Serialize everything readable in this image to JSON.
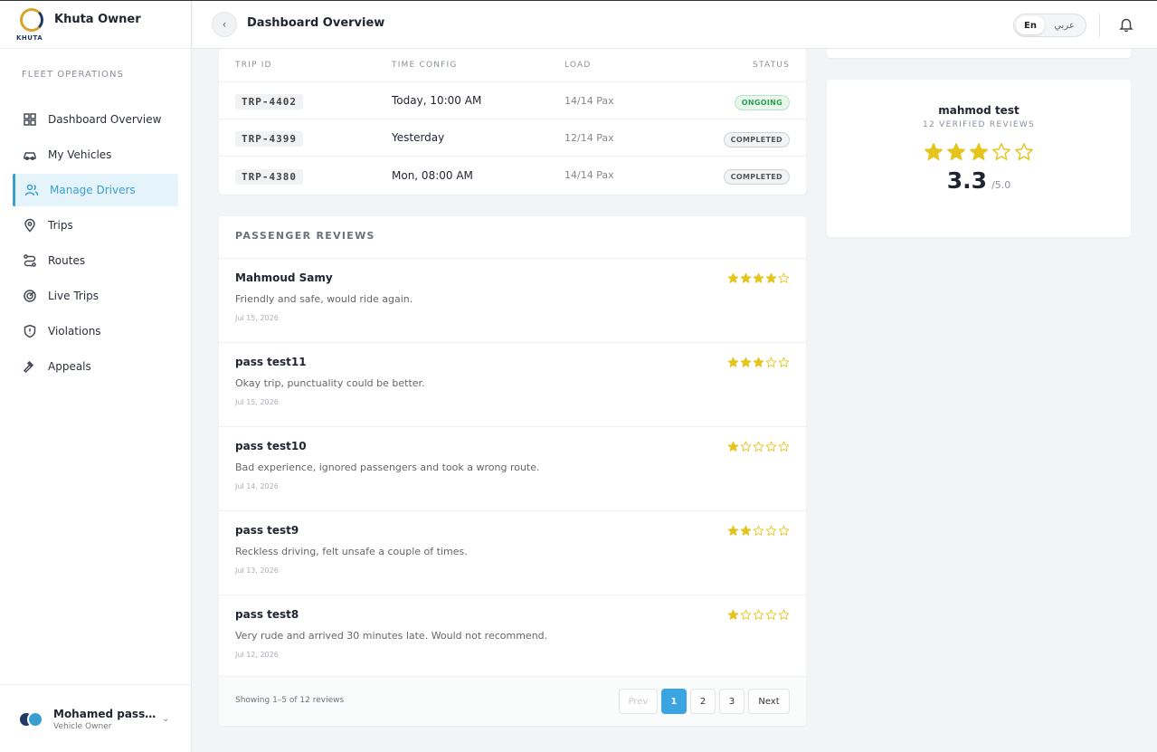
{
  "brand": {
    "name": "Khuta Owner",
    "logo_text": "KHUTA"
  },
  "sidebar": {
    "section_label": "FLEET OPERATIONS",
    "items": [
      {
        "label": "Dashboard Overview",
        "icon": "grid-icon"
      },
      {
        "label": "My Vehicles",
        "icon": "car-icon"
      },
      {
        "label": "Manage Drivers",
        "icon": "users-icon",
        "active": true
      },
      {
        "label": "Trips",
        "icon": "map-pin-icon"
      },
      {
        "label": "Routes",
        "icon": "route-icon"
      },
      {
        "label": "Live Trips",
        "icon": "radar-icon"
      },
      {
        "label": "Violations",
        "icon": "shield-alert-icon"
      },
      {
        "label": "Appeals",
        "icon": "gavel-icon"
      }
    ],
    "user": {
      "name": "Mohamed passeng...",
      "role": "Vehicle Owner"
    }
  },
  "header": {
    "title": "Dashboard Overview",
    "lang_en": "En",
    "lang_ar": "عربي"
  },
  "trips": {
    "columns": [
      "TRIP ID",
      "TIME CONFIG",
      "LOAD",
      "STATUS"
    ],
    "rows": [
      {
        "id": "TRP-4402",
        "time": "Today, 10:00 AM",
        "load": "14/14 Pax",
        "status": "ONGOING"
      },
      {
        "id": "TRP-4399",
        "time": "Yesterday",
        "load": "12/14 Pax",
        "status": "COMPLETED"
      },
      {
        "id": "TRP-4380",
        "time": "Mon, 08:00 AM",
        "load": "14/14 Pax",
        "status": "COMPLETED"
      }
    ]
  },
  "reviews": {
    "title": "PASSENGER REVIEWS",
    "items": [
      {
        "name": "Mahmoud Samy",
        "text": "Friendly and safe, would ride again.",
        "date": "Jul 15, 2026",
        "rating": 4
      },
      {
        "name": "pass test11",
        "text": "Okay trip, punctuality could be better.",
        "date": "Jul 15, 2026",
        "rating": 3
      },
      {
        "name": "pass test10",
        "text": "Bad experience, ignored passengers and took a wrong route.",
        "date": "Jul 14, 2026",
        "rating": 1
      },
      {
        "name": "pass test9",
        "text": "Reckless driving, felt unsafe a couple of times.",
        "date": "Jul 13, 2026",
        "rating": 2
      },
      {
        "name": "pass test8",
        "text": "Very rude and arrived 30 minutes late. Would not recommend.",
        "date": "Jul 12, 2026",
        "rating": 1
      }
    ],
    "showing": "Showing 1–5 of 12 reviews",
    "pager": {
      "prev": "Prev",
      "pages": [
        "1",
        "2",
        "3"
      ],
      "current": "1",
      "next": "Next"
    }
  },
  "rating_card": {
    "driver_name": "mahmod test",
    "subtitle": "12 VERIFIED REVIEWS",
    "score": "3.3",
    "out_of": "/5.0",
    "stars_filled": 3,
    "stars_total": 5
  },
  "colors": {
    "accent": "#3aa5e0",
    "star": "#e5c41d",
    "ongoing": "#2f9c56"
  }
}
